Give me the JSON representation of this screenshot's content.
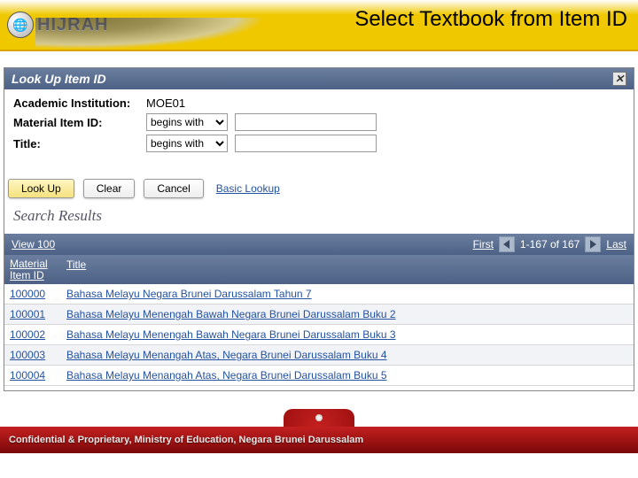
{
  "header": {
    "logo_text": "HIJRAH",
    "slide_title": "Select Textbook from Item ID"
  },
  "window": {
    "title": "Look Up Item ID",
    "form": {
      "label_institution": "Academic Institution:",
      "value_institution": "MOE01",
      "label_material": "Material Item ID:",
      "label_title": "Title:",
      "op_options": [
        "begins with"
      ],
      "op_selected_material": "begins with",
      "op_selected_title": "begins with",
      "input_material": "",
      "input_title": ""
    },
    "buttons": {
      "lookup": "Look Up",
      "clear": "Clear",
      "cancel": "Cancel",
      "basic": "Basic Lookup"
    },
    "results_title": "Search Results",
    "pager": {
      "view100": "View 100",
      "first": "First",
      "range": "1-167 of 167",
      "last": "Last"
    },
    "columns": {
      "id_line1": "Material",
      "id_line2": "Item ID",
      "title": "Title"
    },
    "rows": [
      {
        "id": "100000",
        "title": "Bahasa Melayu Negara Brunei Darussalam Tahun 7"
      },
      {
        "id": "100001",
        "title": "Bahasa Melayu Menengah Bawah Negara Brunei Darussalam Buku 2"
      },
      {
        "id": "100002",
        "title": "Bahasa Melayu Menengah Bawah Negara Brunei Darussalam Buku 3"
      },
      {
        "id": "100003",
        "title": "Bahasa Melayu Menangah Atas, Negara Brunei Darussalam Buku 4"
      },
      {
        "id": "100004",
        "title": "Bahasa Melayu Menangah Atas, Negara Brunei Darussalam Buku 5"
      }
    ]
  },
  "footer": {
    "text": "Confidential & Proprietary, Ministry of Education, Negara Brunei Darussalam"
  }
}
